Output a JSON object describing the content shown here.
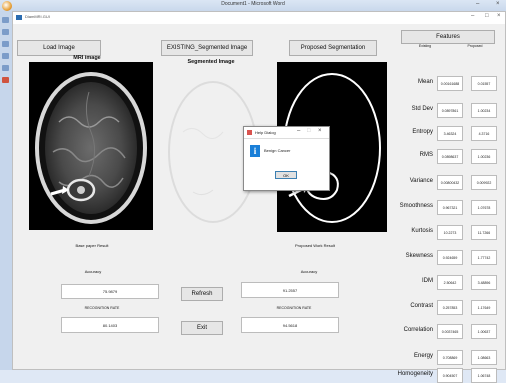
{
  "word": {
    "title": "Document1 - Microsoft Word"
  },
  "figure": {
    "title": "DiamMRI.GUI"
  },
  "buttons": {
    "load_image": "Load Image",
    "existing_seg": "EXISTING_Segmented Image",
    "proposed_seg": "Proposed Segmentation",
    "features": "Features",
    "refresh": "Refresh",
    "exit": "Exit"
  },
  "labels": {
    "mri_image": "MRI image",
    "segmented_image": "Segmented Image",
    "base_paper_result": "Base paper Result",
    "proposed_work_result": "Proposed Work Result",
    "accuracy_left": "Accuracy",
    "accuracy_right": "Accuracy",
    "recognition_left": "RECOGNITION RATE",
    "recognition_right": "RECOGNITION RATE",
    "existing_col": "Existing",
    "proposed_col": "Proposed"
  },
  "results": {
    "base_accuracy": "75.9879",
    "base_recognition": "80.1403",
    "proposed_accuracy": "91.2557",
    "proposed_recognition": "94.5618"
  },
  "features": [
    {
      "name": "Mean",
      "existing": "0.00161688",
      "proposed": "0.01557"
    },
    {
      "name": "Std Dev",
      "existing": "0.0897861",
      "proposed": "1.00234"
    },
    {
      "name": "Entropy",
      "existing": "3.46324",
      "proposed": "4.3716"
    },
    {
      "name": "RMS",
      "existing": "0.0898637",
      "proposed": "1.00236"
    },
    {
      "name": "Variance",
      "existing": "0.00800432",
      "proposed": "0.009922"
    },
    {
      "name": "Smoothness",
      "existing": "0.967321",
      "proposed": "1.07678"
    },
    {
      "name": "Kurtosis",
      "existing": "10.2273",
      "proposed": "11.7266"
    },
    {
      "name": "Skewness",
      "existing": "0.924659",
      "proposed": "1.77742"
    },
    {
      "name": "IDM",
      "existing": "2.50642",
      "proposed": "3.48896"
    },
    {
      "name": "Contrast",
      "existing": "0.257853",
      "proposed": "1.17649"
    },
    {
      "name": "Correlation",
      "existing": "0.0037465",
      "proposed": "1.00637"
    },
    {
      "name": "Energy",
      "existing": "0.708869",
      "proposed": "1.08663"
    },
    {
      "name": "Homogeneity",
      "existing": "0.904507",
      "proposed": "1.06748"
    }
  ],
  "dialog": {
    "title": "Help Dialog",
    "message": "Benign Cancer",
    "ok": "OK"
  }
}
